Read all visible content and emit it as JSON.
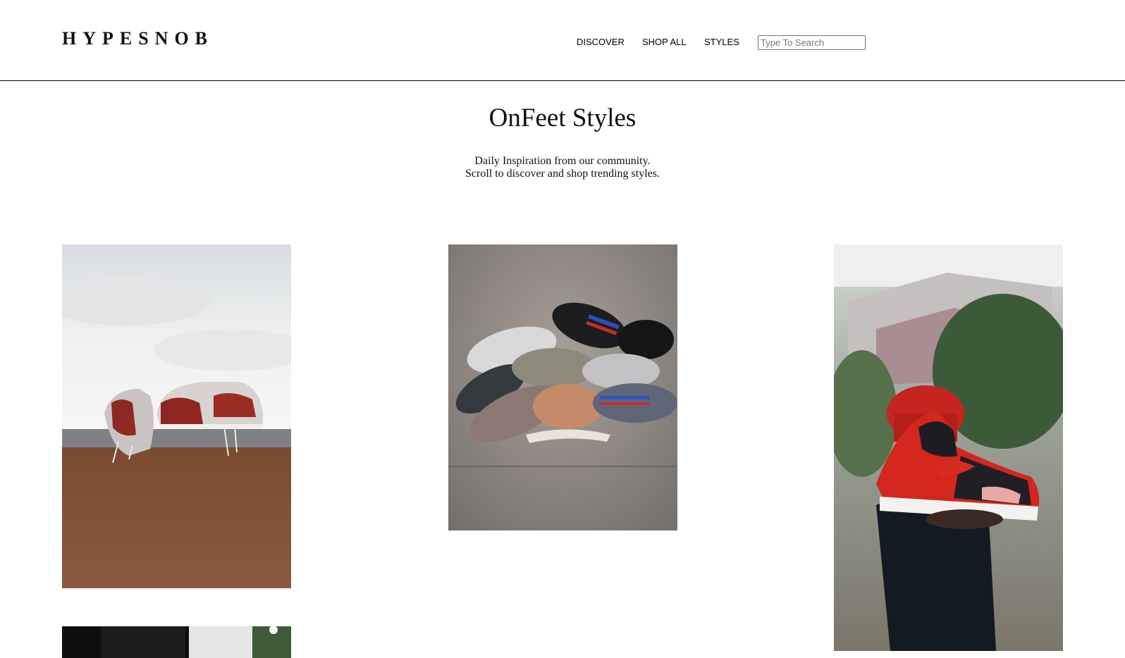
{
  "header": {
    "logo": "HYPESNOB",
    "nav": [
      {
        "label": "DISCOVER"
      },
      {
        "label": "SHOP ALL"
      },
      {
        "label": "STYLES"
      }
    ],
    "search": {
      "placeholder": "Type To Search",
      "value": ""
    }
  },
  "main": {
    "title": "OnFeet Styles",
    "subtitle_lines": [
      "Daily Inspiration from our community.",
      "Scroll to discover and shop trending styles."
    ]
  }
}
